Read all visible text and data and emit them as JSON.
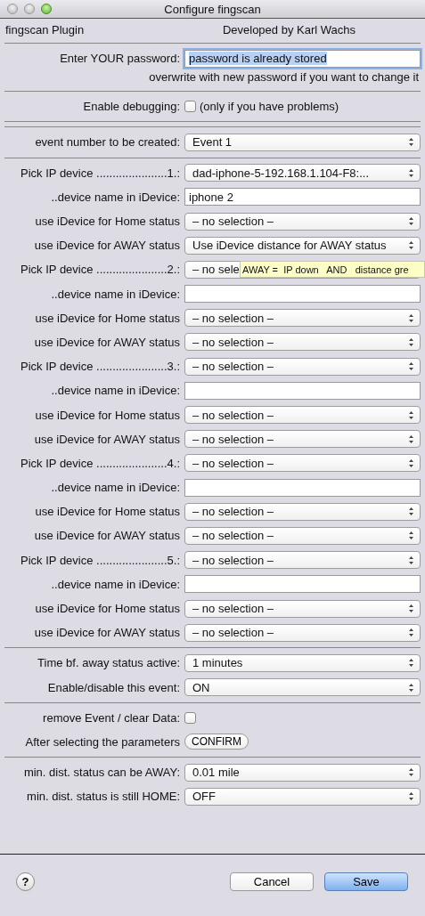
{
  "window": {
    "title": "Configure fingscan"
  },
  "sections": [
    {
      "rows": [
        {
          "kind": "header",
          "label": "fingscan Plugin",
          "value": "Developed by Karl Wachs"
        }
      ]
    },
    {
      "rows": [
        {
          "kind": "textfield",
          "label": "Enter YOUR password:",
          "value": "password is already stored",
          "focused": true
        },
        {
          "kind": "note",
          "value": "overwrite with new password if you want to change it"
        }
      ]
    },
    {
      "rows": [
        {
          "kind": "checkbox",
          "label": "Enable debugging:",
          "checked": false,
          "value": "(only if you have problems)"
        }
      ]
    },
    {
      "rows": [
        {
          "kind": "popup",
          "label": "event number to be created:",
          "value": "Event 1"
        }
      ]
    },
    {
      "rows": [
        {
          "kind": "popup",
          "label": "Pick IP device ......................1.:",
          "value": "dad-iphone-5-192.168.1.104-F8:..."
        },
        {
          "kind": "textfield",
          "label": "..device name in iDevice:",
          "value": "iphone 2",
          "focused": false
        },
        {
          "kind": "popup",
          "label": "use iDevice for Home status",
          "value": "– no selection –"
        },
        {
          "kind": "popup",
          "label": "use iDevice for AWAY status",
          "value": "Use iDevice distance for AWAY status"
        },
        {
          "kind": "popup",
          "label": "Pick IP device ......................2.:",
          "value": "– no sele",
          "tooltip": "AWAY =  IP down   AND   distance gre"
        },
        {
          "kind": "textfield",
          "label": "..device name in iDevice:",
          "value": "",
          "focused": false
        },
        {
          "kind": "popup",
          "label": "use iDevice for Home status",
          "value": "– no selection –"
        },
        {
          "kind": "popup",
          "label": "use iDevice for AWAY status",
          "value": "– no selection –"
        },
        {
          "kind": "popup",
          "label": "Pick IP device ......................3.:",
          "value": "– no selection –"
        },
        {
          "kind": "textfield",
          "label": "..device name in iDevice:",
          "value": "",
          "focused": false
        },
        {
          "kind": "popup",
          "label": "use iDevice for Home status",
          "value": "– no selection –"
        },
        {
          "kind": "popup",
          "label": "use iDevice for AWAY status",
          "value": "– no selection –"
        },
        {
          "kind": "popup",
          "label": "Pick IP device ......................4.:",
          "value": "– no selection –"
        },
        {
          "kind": "textfield",
          "label": "..device name in iDevice:",
          "value": "",
          "focused": false
        },
        {
          "kind": "popup",
          "label": "use iDevice for Home status",
          "value": "– no selection –"
        },
        {
          "kind": "popup",
          "label": "use iDevice for AWAY status",
          "value": "– no selection –"
        },
        {
          "kind": "popup",
          "label": "Pick IP device ......................5.:",
          "value": "– no selection –"
        },
        {
          "kind": "textfield",
          "label": "..device name in iDevice:",
          "value": "",
          "focused": false
        },
        {
          "kind": "popup",
          "label": "use iDevice for Home status",
          "value": "– no selection –"
        },
        {
          "kind": "popup",
          "label": "use iDevice for AWAY status",
          "value": "– no selection –"
        }
      ]
    },
    {
      "rows": [
        {
          "kind": "popup",
          "label": "Time bf. away status active:",
          "value": "1 minutes"
        },
        {
          "kind": "popup",
          "label": "Enable/disable this event:",
          "value": "ON"
        }
      ]
    },
    {
      "rows": [
        {
          "kind": "checkbox",
          "label": "remove Event / clear Data:",
          "checked": false
        },
        {
          "kind": "button",
          "label": "After selecting the parameters",
          "value": "CONFIRM"
        }
      ]
    },
    {
      "rows": [
        {
          "kind": "popup",
          "label": "min. dist. status can be AWAY:",
          "value": "0.01 mile"
        },
        {
          "kind": "popup",
          "label": "min. dist. status is still HOME:",
          "value": "OFF"
        }
      ]
    }
  ],
  "footer": {
    "help": "?",
    "buttons": [
      {
        "label": "Cancel",
        "default": false
      },
      {
        "label": "Save",
        "default": true
      }
    ]
  }
}
